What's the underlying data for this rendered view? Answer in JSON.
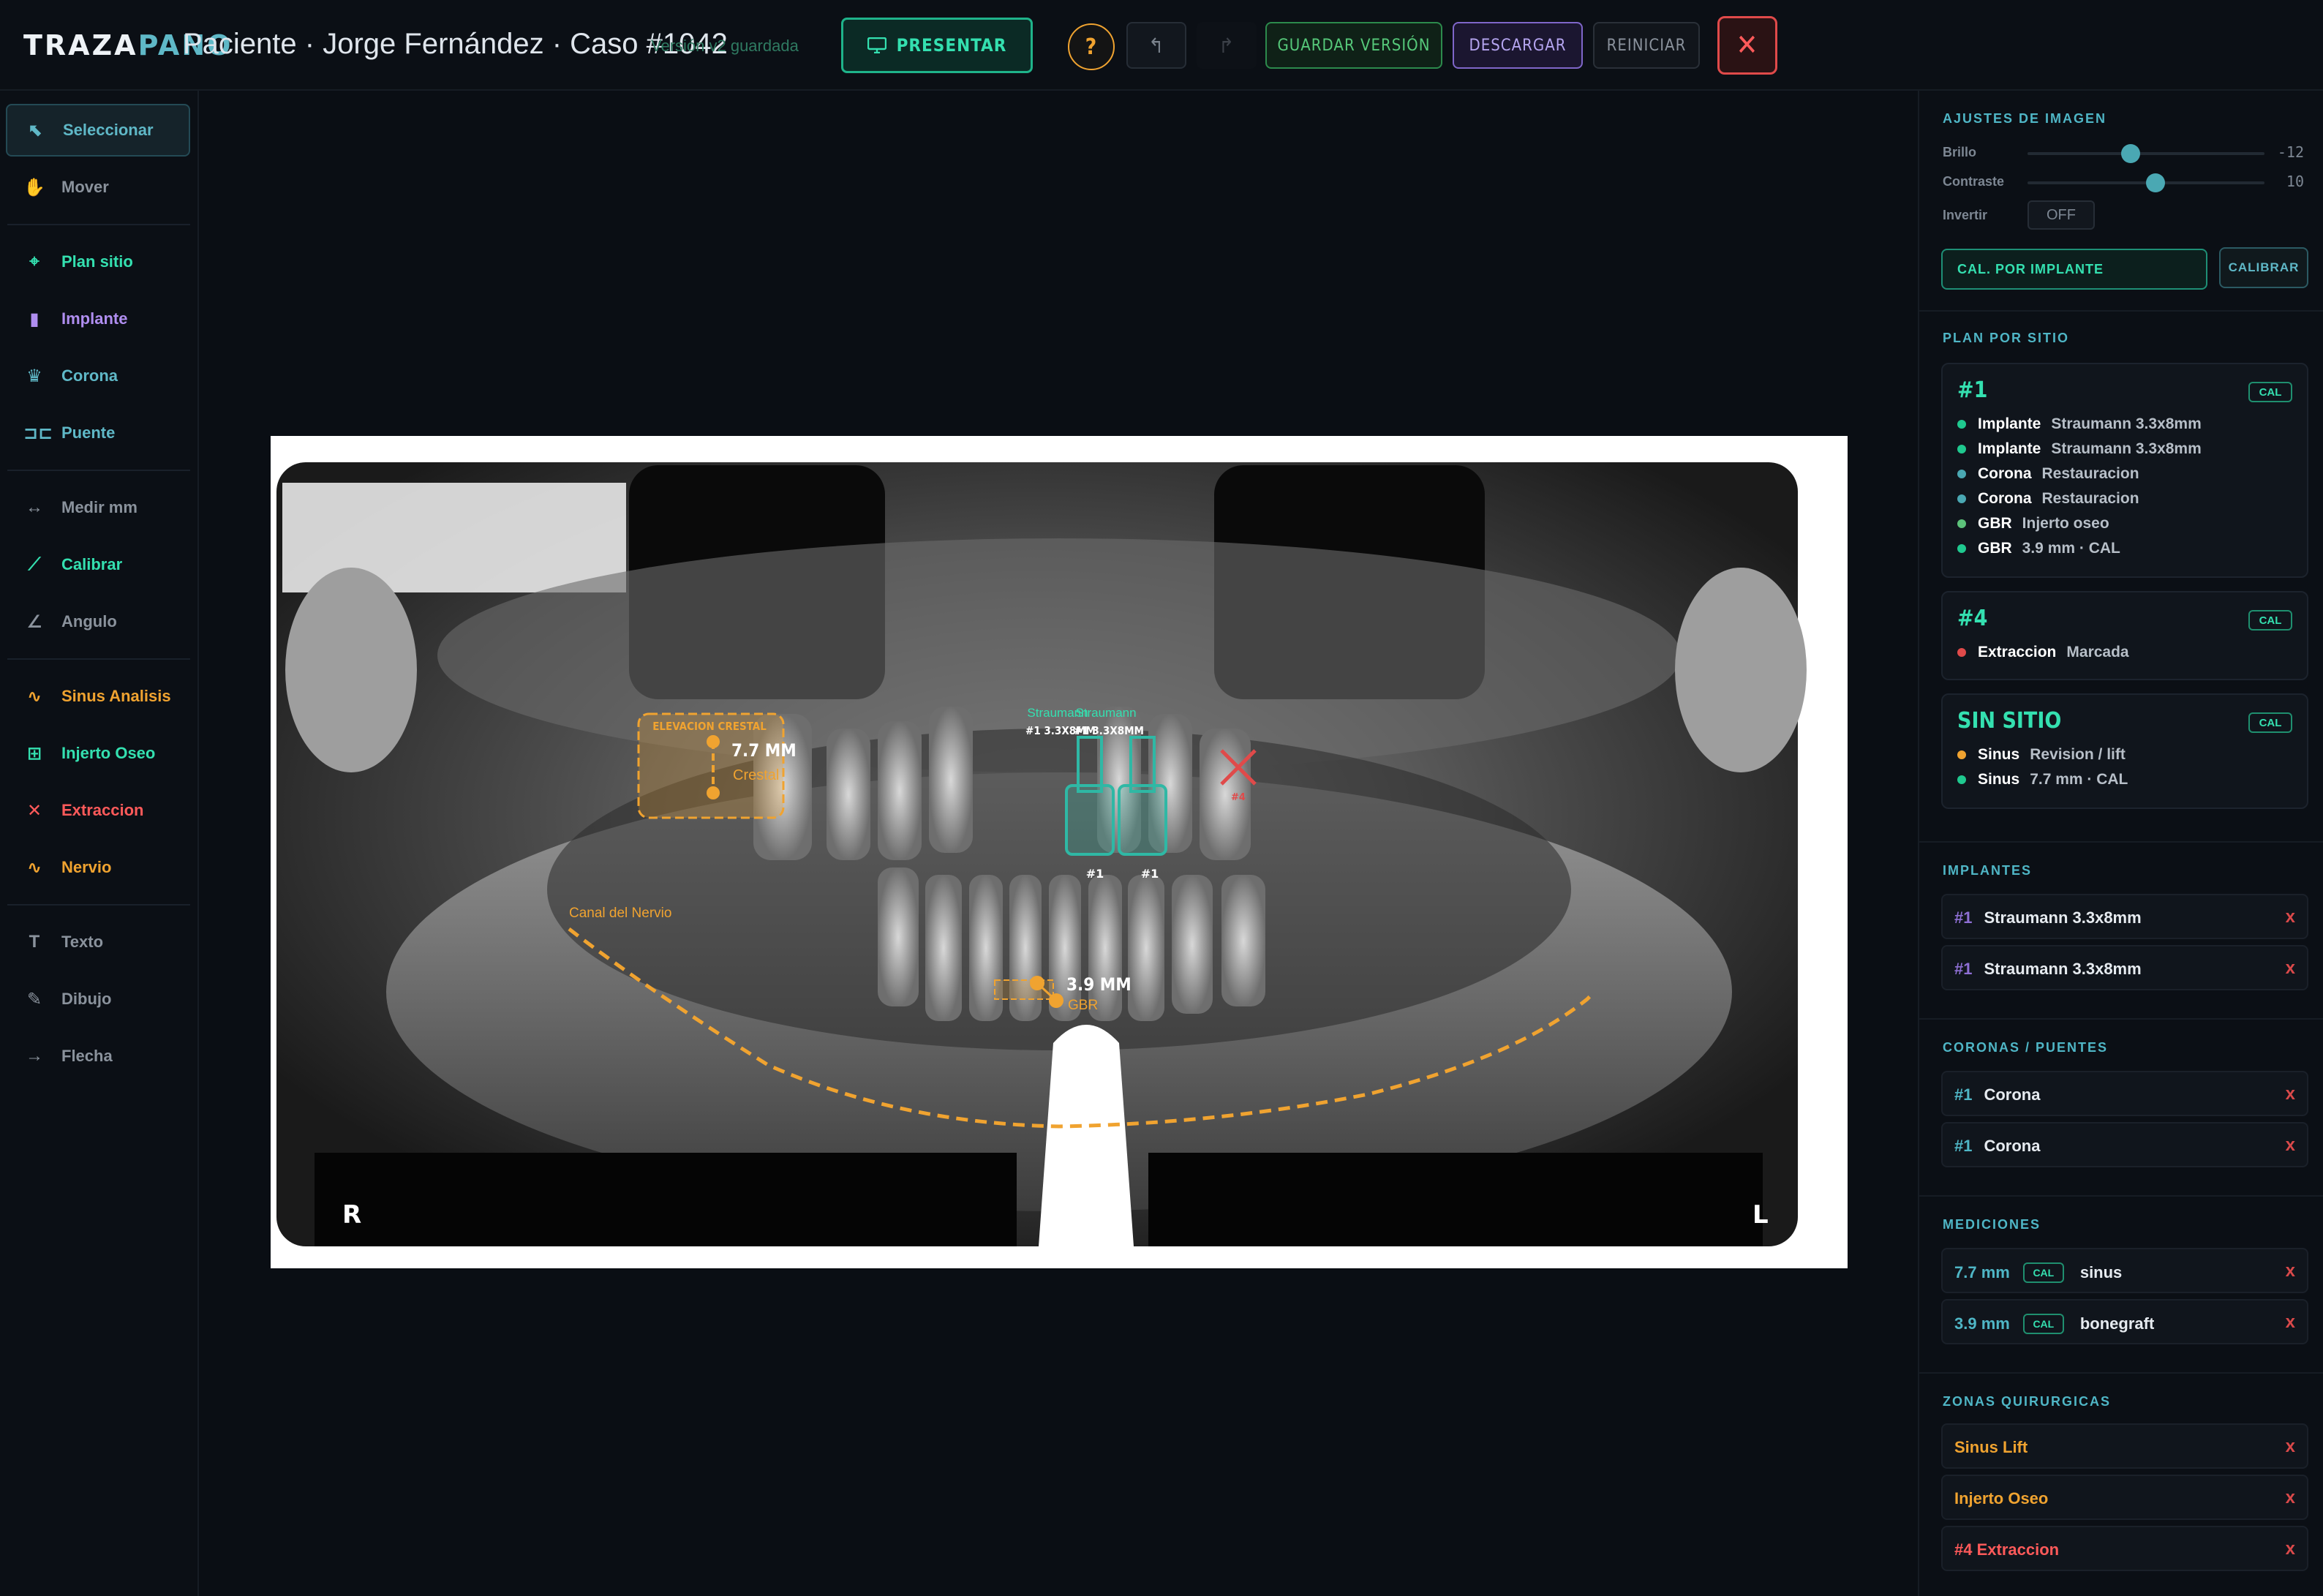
{
  "header": {
    "logo_a": "TRAZA",
    "logo_b": "PANO",
    "case_title": "Paciente · Jorge Fernández · Caso #1042",
    "saved_status": "Versión v2 guardada",
    "present_label": "PRESENTAR",
    "help_label": "?",
    "undo_label": "↰",
    "redo_label": "↱",
    "save_version_label": "GUARDAR VERSIÓN",
    "download_label": "DESCARGAR",
    "reset_label": "REINICIAR",
    "close_label": "✕"
  },
  "tools": [
    {
      "label": "Seleccionar",
      "icon": "cursor-icon",
      "glyph": "⬉",
      "color": "#5fb8c7"
    },
    {
      "label": "Mover",
      "icon": "hand-icon",
      "glyph": "✋",
      "color": "#8a929c"
    },
    {
      "label": "Plan sitio",
      "icon": "target-icon",
      "glyph": "⌖",
      "color": "#34e0b0"
    },
    {
      "label": "Implante",
      "icon": "implant-icon",
      "glyph": "▮",
      "color": "#b08ef0"
    },
    {
      "label": "Corona",
      "icon": "crown-icon",
      "glyph": "♛",
      "color": "#5fb8c7"
    },
    {
      "label": "Puente",
      "icon": "bridge-icon",
      "glyph": "⊐⊏",
      "color": "#5fb8c7"
    },
    {
      "label": "Medir mm",
      "icon": "ruler-icon",
      "glyph": "↔",
      "color": "#8a929c"
    },
    {
      "label": "Calibrar",
      "icon": "calibrate-icon",
      "glyph": "⟋",
      "color": "#34e0b0"
    },
    {
      "label": "Angulo",
      "icon": "angle-icon",
      "glyph": "∠",
      "color": "#8a929c"
    },
    {
      "label": "Sinus Analisis",
      "icon": "wave-icon",
      "glyph": "∿",
      "color": "#f0a330"
    },
    {
      "label": "Injerto Oseo",
      "icon": "grid-icon",
      "glyph": "⊞",
      "color": "#34e0b0"
    },
    {
      "label": "Extraccion",
      "icon": "x-icon",
      "glyph": "✕",
      "color": "#ff5a5a"
    },
    {
      "label": "Nervio",
      "icon": "nerve-icon",
      "glyph": "∿",
      "color": "#f0a330"
    },
    {
      "label": "Texto",
      "icon": "text-icon",
      "glyph": "T",
      "color": "#8a929c"
    },
    {
      "label": "Dibujo",
      "icon": "pen-icon",
      "glyph": "✎",
      "color": "#8a929c"
    },
    {
      "label": "Flecha",
      "icon": "arrow-icon",
      "glyph": "→",
      "color": "#8a929c"
    }
  ],
  "xray": {
    "label_r": "R",
    "label_l": "L",
    "crestal_title": "ELEVACION CRESTAL",
    "crestal_measure": "7.7 MM",
    "crestal_sub": "Crestal",
    "implant_brand_a": "Straumann",
    "implant_brand_b": "Straumann",
    "implant_tag_a": "#1 3.3X8MM",
    "implant_tag_b": "#1 3.3X8MM",
    "implant_num_a": "#1",
    "implant_num_b": "#1",
    "extraction_tag": "#4",
    "nerve_label": "Canal del Nervio",
    "gbr_measure": "3.9 MM",
    "gbr_sub": "GBR"
  },
  "image_settings": {
    "title": "AJUSTES DE IMAGEN",
    "brightness_label": "Brillo",
    "brightness_value": "-12",
    "contrast_label": "Contraste",
    "contrast_value": "10",
    "invert_label": "Invertir",
    "invert_value": "OFF",
    "cal_implant_label": "CAL. POR IMPLANTE",
    "calibrate_label": "CALIBRAR"
  },
  "site_plan": {
    "title": "PLAN POR SITIO",
    "sites": [
      {
        "id": "#1",
        "badge": "CAL",
        "items": [
          {
            "k": "Implante",
            "v": "Straumann 3.3x8mm",
            "color": "#1fc98f"
          },
          {
            "k": "Implante",
            "v": "Straumann 3.3x8mm",
            "color": "#1fc98f"
          },
          {
            "k": "Corona",
            "v": "Restauracion",
            "color": "#4aa8b3"
          },
          {
            "k": "Corona",
            "v": "Restauracion",
            "color": "#4aa8b3"
          },
          {
            "k": "GBR",
            "v": "Injerto oseo",
            "color": "#5cc27a"
          },
          {
            "k": "GBR",
            "v": "3.9 mm · CAL",
            "color": "#1fc98f"
          }
        ]
      },
      {
        "id": "#4",
        "badge": "CAL",
        "items": [
          {
            "k": "Extraccion",
            "v": "Marcada",
            "color": "#e04a4a"
          }
        ]
      },
      {
        "id": "SIN SITIO",
        "badge": "CAL",
        "items": [
          {
            "k": "Sinus",
            "v": "Revision / lift",
            "color": "#f0a330"
          },
          {
            "k": "Sinus",
            "v": "7.7 mm · CAL",
            "color": "#1fc98f"
          }
        ]
      }
    ]
  },
  "implants": {
    "title": "IMPLANTES",
    "rows": [
      {
        "num": "#1",
        "label": "Straumann 3.3x8mm"
      },
      {
        "num": "#1",
        "label": "Straumann 3.3x8mm"
      }
    ]
  },
  "crowns": {
    "title": "CORONAS / PUENTES",
    "rows": [
      {
        "num": "#1",
        "label": "Corona"
      },
      {
        "num": "#1",
        "label": "Corona"
      }
    ]
  },
  "measurements": {
    "title": "MEDICIONES",
    "rows": [
      {
        "value": "7.7 mm",
        "badge": "CAL",
        "label": "sinus"
      },
      {
        "value": "3.9 mm",
        "badge": "CAL",
        "label": "bonegraft"
      }
    ]
  },
  "zones": {
    "title": "ZONAS QUIRURGICAS",
    "rows": [
      {
        "label": "Sinus Lift",
        "color": "#f0a330"
      },
      {
        "label": "Injerto Oseo",
        "color": "#f0a330"
      },
      {
        "label": "#4 Extraccion",
        "color": "#ff5a5a"
      }
    ]
  },
  "remove_glyph": "x"
}
